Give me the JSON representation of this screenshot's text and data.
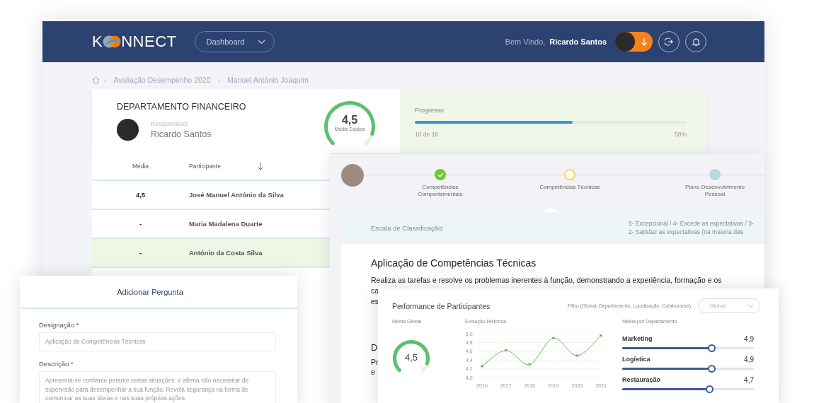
{
  "header": {
    "logo": {
      "lead": "K",
      "trail": "NNECT"
    },
    "menu": {
      "value": "Dashboard"
    },
    "greeting": "Bem Vindo,",
    "user_name": "Ricardo Santos"
  },
  "breadcrumb": [
    {
      "separator": "-",
      "label": "Avaliação Desempenho 2020"
    },
    {
      "separator": "-",
      "label": "Manuel António Joaquim"
    }
  ],
  "department": {
    "title": "DEPARTAMENTO FINANCEIRO",
    "role_label": "Responsável",
    "manager": "Ricardo Santos",
    "team_average": {
      "value": "4,5",
      "label": "Média Equipa",
      "level": 0.9
    },
    "progress": {
      "label": "Progresso",
      "level": 0.58,
      "count": "10 de 18",
      "percent": "58%"
    }
  },
  "participants_table": {
    "columns": [
      "Média",
      "Participante"
    ],
    "rows": [
      {
        "average": "4,5",
        "name": "José Manuel António da Silva",
        "selected": false
      },
      {
        "average": "-",
        "name": "Maria Madalena Duarte",
        "selected": false
      },
      {
        "average": "-",
        "name": "António da Costa Silva",
        "selected": true
      }
    ]
  },
  "assessment": {
    "steps": [
      {
        "label": "Competências Comportamentais",
        "completed": true,
        "selected": false
      },
      {
        "label": "Competências Técnicas",
        "completed": false,
        "selected": true
      },
      {
        "label": "Plano Desenvolvimento Pessoal",
        "completed": false,
        "selected": false
      }
    ],
    "scale_label": "Escala de Classificação:",
    "scale_lines": [
      "5- Excepcional / 4- Excede as expectativas / 3-",
      "2- Satisfaz as expectativas (na maioria das"
    ],
    "title": "Aplicação de Competências Técnicas",
    "description_lines": [
      "Realiza as tarefas e resolve os problemas inerentes à função, demonstrando a experiência, formação e os",
      "ca",
      "es"
    ],
    "section_heading": "D",
    "section_lines": [
      "Pr",
      "e"
    ]
  },
  "add_question": {
    "title": "Adicionar Pergunta",
    "fields": [
      {
        "label": "Designação *",
        "kind": "input",
        "placeholder": "Aplicação de Competências Técnicas"
      },
      {
        "label": "Descrição *",
        "kind": "textarea",
        "placeholder": "Apresenta-se confiante perante certas situações  e afirma não necessitar de supervisão para desempenhar a sua função. Revela segurança na forma de comunicar as suas ideias e nas suas próprias ações."
      }
    ]
  },
  "performance": {
    "title": "Performance de Participantes",
    "filter_label": "Filtro (Global, Departamento, Localização, Colaborador)",
    "filter": {
      "value": "Global"
    },
    "global_average": {
      "label": "Média Global",
      "value": "4,5",
      "level": 0.9
    },
    "history": {
      "label": "Evolução Histórica",
      "chart_data": {
        "type": "line",
        "grid": true,
        "categories": [
          "2016",
          "2017",
          "2018",
          "2019",
          "2020",
          "2021"
        ],
        "series": [
          {
            "color": "#5cc04a",
            "values": [
              4.26,
              4.62,
              4.3,
              4.9,
              4.5,
              4.96
            ]
          }
        ],
        "ylim": [
          4.0,
          5.0
        ],
        "yticks": [
          {
            "value": 4.0,
            "label": "4,0"
          },
          {
            "value": 4.2,
            "label": "4,2"
          },
          {
            "value": 4.4,
            "label": "4,4"
          },
          {
            "value": 4.6,
            "label": "4,6"
          },
          {
            "value": 4.8,
            "label": "4,8"
          },
          {
            "value": 5.0,
            "label": "5,0"
          }
        ]
      }
    },
    "departments": {
      "label": "Média por Departamento",
      "items": [
        {
          "name": "Marketing",
          "value": "4,9",
          "level": 0.68
        },
        {
          "name": "Logística",
          "value": "4,9",
          "level": 0.68
        },
        {
          "name": "Restauração",
          "value": "4,7",
          "level": 0.66
        }
      ]
    }
  }
}
